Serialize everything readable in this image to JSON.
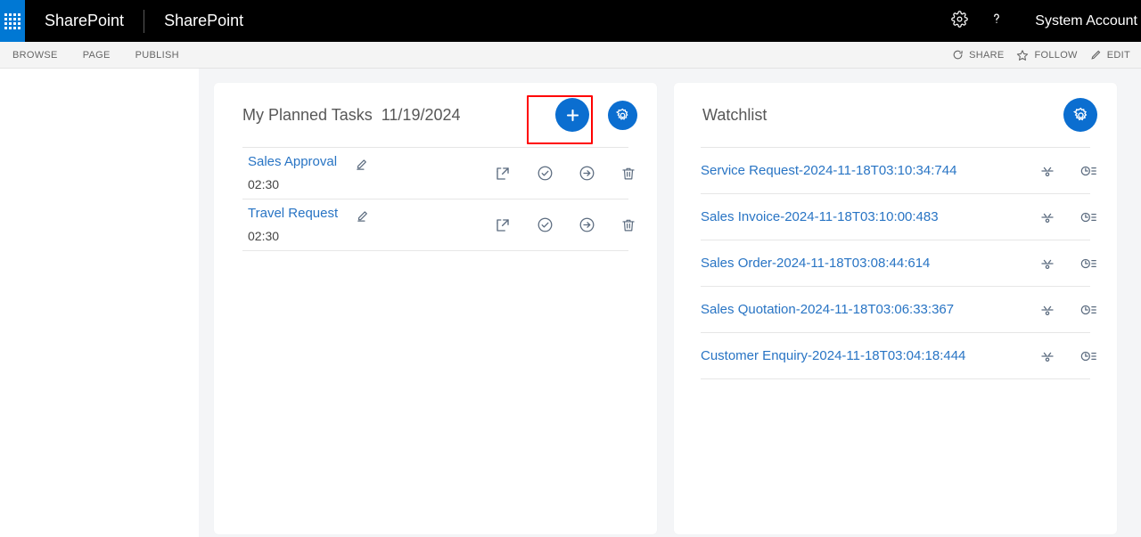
{
  "suite_bar": {
    "waffle_icon": "waffle-grid-icon",
    "brand": "SharePoint",
    "site": "SharePoint",
    "settings_icon": "gear-icon",
    "help_icon": "question-mark-icon",
    "user": "System Account"
  },
  "ribbon": {
    "tabs": [
      {
        "label": "BROWSE"
      },
      {
        "label": "PAGE"
      },
      {
        "label": "PUBLISH"
      }
    ],
    "actions": [
      {
        "label": "SHARE",
        "icon": "share-icon"
      },
      {
        "label": "FOLLOW",
        "icon": "star-icon"
      },
      {
        "label": "EDIT",
        "icon": "pencil-icon"
      }
    ]
  },
  "tasks_card": {
    "title": "My Planned Tasks",
    "date": "11/19/2024",
    "add_button": {
      "icon": "plus-icon",
      "label": ""
    },
    "settings_button": {
      "icon": "gear-icon",
      "label": ""
    },
    "highlight_color": "#ff0000",
    "accent_color": "#0b6ed0",
    "row_icons": [
      {
        "name": "open-external-icon"
      },
      {
        "name": "check-circle-icon"
      },
      {
        "name": "arrow-right-circle-icon"
      },
      {
        "name": "trash-icon"
      }
    ],
    "rows": [
      {
        "name": "Sales Approval",
        "time": "02:30",
        "edit_icon": "pencil-edit-icon"
      },
      {
        "name": "Travel Request",
        "time": "02:30",
        "edit_icon": "pencil-edit-icon"
      }
    ]
  },
  "watchlist_card": {
    "title": "Watchlist",
    "settings_button": {
      "icon": "gear-icon",
      "label": ""
    },
    "accent_color": "#0b6ed0",
    "row_icons": [
      {
        "name": "workflow-icon"
      },
      {
        "name": "history-list-icon"
      }
    ],
    "rows": [
      {
        "name": "Service Request-2024-11-18T03:10:34:744"
      },
      {
        "name": "Sales Invoice-2024-11-18T03:10:00:483"
      },
      {
        "name": "Sales Order-2024-11-18T03:08:44:614"
      },
      {
        "name": "Sales Quotation-2024-11-18T03:06:33:367"
      },
      {
        "name": "Customer Enquiry-2024-11-18T03:04:18:444"
      }
    ]
  }
}
